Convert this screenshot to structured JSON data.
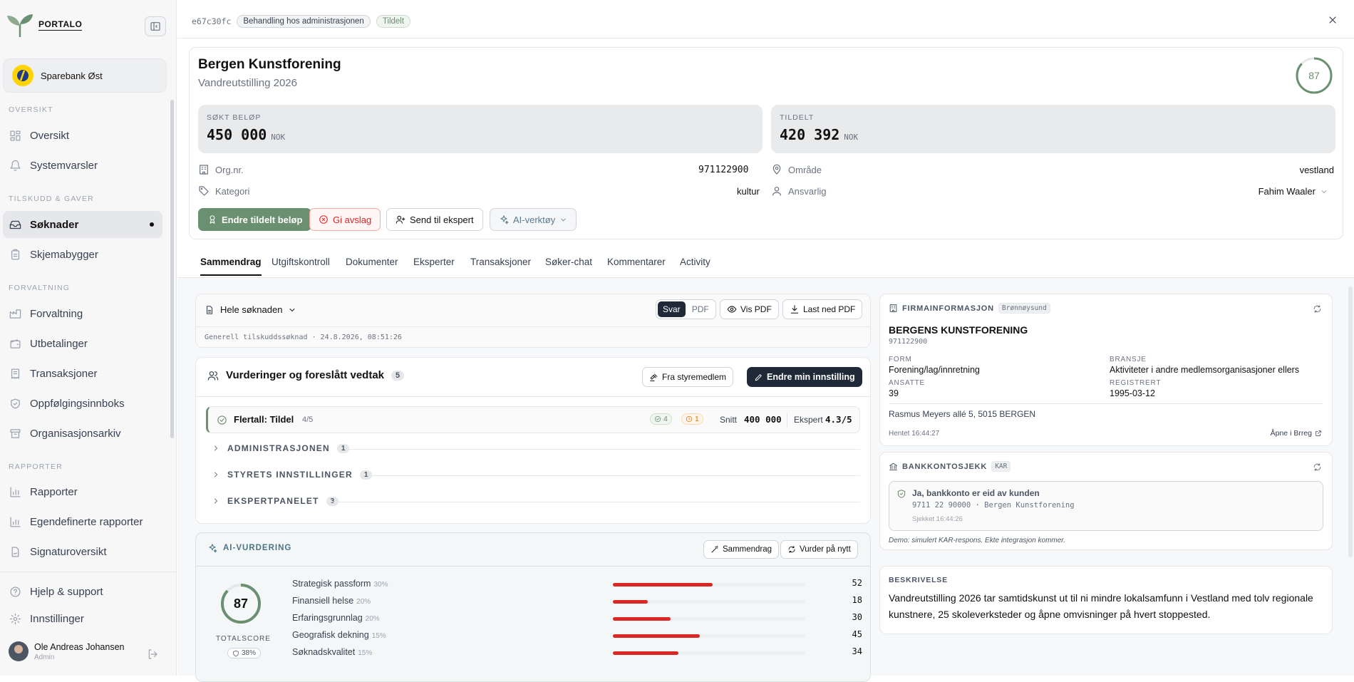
{
  "sidebar": {
    "brand": "PORTALO",
    "org": "Sparebank Øst",
    "sections": {
      "oversikt": "OVERSIKT",
      "tilskudd": "TILSKUDD & GAVER",
      "forvaltning": "FORVALTNING",
      "rapporter": "RAPPORTER"
    },
    "items": {
      "oversikt": "Oversikt",
      "systemvarsler": "Systemvarsler",
      "soknader": "Søknader",
      "skjemabygger": "Skjemabygger",
      "forvaltning": "Forvaltning",
      "utbetalinger": "Utbetalinger",
      "transaksjoner": "Transaksjoner",
      "oppfolging": "Oppfølgingsinnboks",
      "arkiv": "Organisasjonsarkiv",
      "rapporter": "Rapporter",
      "egendef": "Egendefinerte rapporter",
      "signatur": "Signaturoversikt",
      "hjelp": "Hjelp & support",
      "innstillinger": "Innstillinger"
    },
    "user": {
      "name": "Ole Andreas Johansen",
      "role": "Admin"
    }
  },
  "topbar": {
    "id": "e67c30fc",
    "status1": "Behandling hos administrasjonen",
    "status2": "Tildelt"
  },
  "header": {
    "title": "Bergen Kunstforening",
    "subtitle": "Vandreutstilling 2026",
    "score": "87",
    "score_value": 87,
    "sokt_label": "SØKT BELØP",
    "sokt_value": "450 000",
    "tildelt_label": "TILDELT",
    "tildelt_value": "420 392",
    "currency": "NOK",
    "orgnr_label": "Org.nr.",
    "orgnr": "971122900",
    "kategori_label": "Kategori",
    "kategori": "kultur",
    "omrade_label": "Område",
    "omrade": "vestland",
    "ansvarlig_label": "Ansvarlig",
    "ansvarlig": "Fahim Waaler",
    "buttons": {
      "endre": "Endre tildelt beløp",
      "avslag": "Gi avslag",
      "ekspert": "Send til ekspert",
      "ai": "AI-verktøy"
    }
  },
  "tabs": [
    "Sammendrag",
    "Utgiftskontroll",
    "Dokumenter",
    "Eksperter",
    "Transaksjoner",
    "Søker-chat",
    "Kommentarer",
    "Activity"
  ],
  "soknad": {
    "selector": "Hele søknaden",
    "seg_svar": "Svar",
    "seg_pdf": "PDF",
    "vis_pdf": "Vis PDF",
    "last_ned": "Last ned PDF",
    "meta": "Generell tilskuddssøknad · 24.8.2026, 08:51:26"
  },
  "vurderinger": {
    "title": "Vurderinger og foreslått vedtak",
    "count": "5",
    "fra_styre": "Fra styremedlem",
    "endre": "Endre min innstilling",
    "flertall": "Flertall: Tildel",
    "flertall_frac": "4/5",
    "ok_count": "4",
    "warn_count": "1",
    "snitt_label": "Snitt",
    "snitt": "400 000",
    "ekspert_label": "Ekspert",
    "ekspert": "4.3/5",
    "sections": [
      {
        "label": "ADMINISTRASJONEN",
        "count": "1"
      },
      {
        "label": "STYRETS INNSTILLINGER",
        "count": "1"
      },
      {
        "label": "EKSPERTPANELET",
        "count": "3"
      }
    ]
  },
  "ai": {
    "title": "AI-VURDERING",
    "sammendrag": "Sammendrag",
    "vurder": "Vurder på nytt",
    "score": "87",
    "score_value": 87,
    "total_label": "TOTALSCORE",
    "confidence": "38%",
    "criteria": [
      {
        "name": "Strategisk passform",
        "weight": "30%",
        "value": 52
      },
      {
        "name": "Finansiell helse",
        "weight": "20%",
        "value": 18
      },
      {
        "name": "Erfaringsgrunnlag",
        "weight": "20%",
        "value": 30
      },
      {
        "name": "Geografisk dekning",
        "weight": "15%",
        "value": 45
      },
      {
        "name": "Søknadskvalitet",
        "weight": "15%",
        "value": 34
      }
    ]
  },
  "firma": {
    "title": "FIRMAINFORMASJON",
    "source": "Brønnøysund",
    "name": "BERGENS KUNSTFORENING",
    "orgnr": "971122900",
    "form_label": "FORM",
    "form": "Forening/lag/innretning",
    "bransje_label": "BRANSJE",
    "bransje": "Aktiviteter i andre medlemsorganisasjoner ellers",
    "ansatte_label": "ANSATTE",
    "ansatte": "39",
    "reg_label": "REGISTRERT",
    "reg": "1995-03-12",
    "adresse": "Rasmus Meyers allé 5, 5015 BERGEN",
    "hentet": "Hentet 16:44:27",
    "apne": "Åpne i Brreg"
  },
  "bank": {
    "title": "BANKKONTOSJEKK",
    "source": "KAR",
    "ok": "Ja, bankkonto er eid av kunden",
    "detail": "9711 22 90000 · Bergen Kunstforening",
    "checked": "Sjekket 16:44:26",
    "demo": "Demo: simulert KAR-respons. Ekte integrasjon kommer."
  },
  "beskrivelse": {
    "title": "BESKRIVELSE",
    "text": "Vandreutstilling 2026 tar samtidskunst ut til ni mindre lokalsamfunn i Vestland med tolv regionale kunstnere, 25 skoleverksteder og åpne omvisninger på hvert stoppested."
  },
  "colors": {
    "accent": "#6b8f71",
    "danger": "#dc2626",
    "dark": "#1f2937"
  }
}
